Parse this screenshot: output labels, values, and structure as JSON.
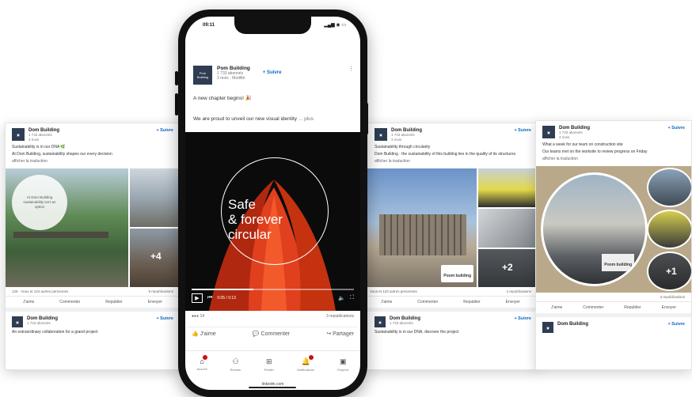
{
  "org": {
    "name": "Dom Building",
    "name_phone": "Pom Building",
    "followers_phone": "1 733 abonnés",
    "age_phone": "3 mois · Modifié",
    "followers": "1 733 abonnés",
    "age": "3 mois"
  },
  "follow_label": "+ Suivre",
  "phone": {
    "time": "09:11",
    "status_icons": "▂▄▆ ◉ ▭",
    "post_text_1": "A new chapter begins! 🎉",
    "post_text_2": "We are proud to unveil our new visual identity",
    "more": "... plus",
    "video_title_1": "Safe",
    "video_title_2": "& forever",
    "video_title_3": "circular",
    "video_time": "0:05 / 0:13",
    "video_progress": 0.38,
    "reactions_count": "14",
    "reposts": "3 republications",
    "like": "J'aime",
    "comment": "Commenter",
    "share": "Partager",
    "tabs": [
      {
        "label": "Accueil",
        "icon": "⌂"
      },
      {
        "label": "Réseau",
        "icon": "⚇"
      },
      {
        "label": "Publier",
        "icon": "⊞"
      },
      {
        "label": "Notifications",
        "icon": "🔔"
      },
      {
        "label": "Emplois",
        "icon": "▣"
      }
    ],
    "url": "linkedin.com"
  },
  "card_left": {
    "line1": "Sustainability is in our DNA 🌿",
    "line2": "At Dom Building, sustainability shapes our every decision",
    "line3": "afficher la traduction",
    "overlay": "At Dom Building sustainability isn't an option",
    "plus": "+4",
    "stats": "125 · Vous et 124 autres personnes",
    "reposts": "9 republications",
    "actions": [
      "J'aime",
      "Commenter",
      "Republier",
      "Envoyer"
    ],
    "next_text": "An extraordinary collaboration for a grand project"
  },
  "card_mid": {
    "line1": "Sustainability through circularity",
    "line2": "Dom Building · the sustainability of this building lies in the quality of its structures",
    "line3": "afficher la traduction",
    "brand": "Poom building",
    "plus": "+2",
    "stats": "Vous et 120 autres personnes",
    "reposts": "4 republications",
    "actions": [
      "J'aime",
      "Commenter",
      "Republier",
      "Envoyer"
    ],
    "next_text": "Sustainability is in our DNA, discover the project"
  },
  "card_right": {
    "line1": "What a week for our team on construction site",
    "line2": "Our teams met on the worksite to review progress on Friday",
    "line3": "afficher la traduction",
    "brand": "Poom building",
    "plus": "+1",
    "stats": "3 republications",
    "actions": [
      "J'aime",
      "Commenter",
      "Republier",
      "Envoyer"
    ]
  },
  "colors": {
    "brand_navy": "#2f3d52",
    "link_blue": "#0a66c2",
    "accent_red": "#cc1016",
    "video_orange": "#e0401e"
  }
}
